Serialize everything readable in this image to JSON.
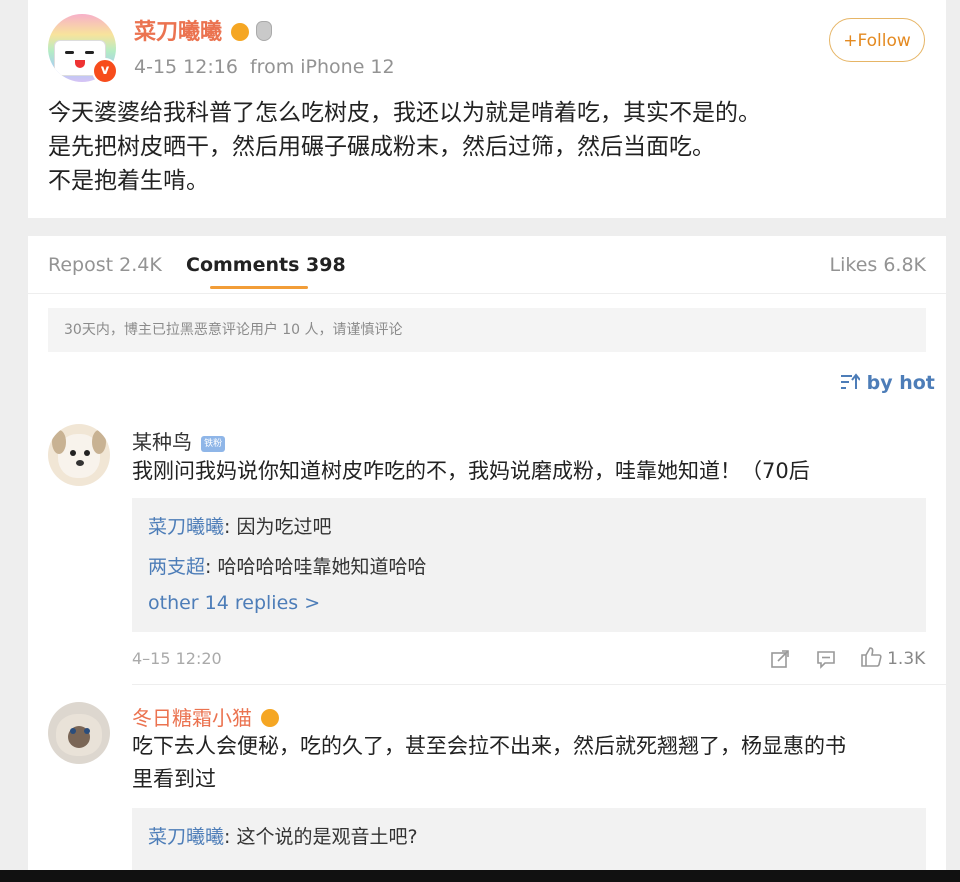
{
  "post": {
    "username": "菜刀曦曦",
    "meta": "4-15 12:16  from iPhone 12",
    "follow_label": "+Follow",
    "verified_mark": "v",
    "lines": [
      "今天婆婆给我科普了怎么吃树皮，我还以为就是啃着吃，其实不是的。",
      "是先把树皮晒干，然后用碾子碾成粉末，然后过筛，然后当面吃。",
      "不是抱着生啃。"
    ]
  },
  "tabs": {
    "repost": "Repost 2.4K",
    "comments": "Comments 398",
    "likes": "Likes 6.8K"
  },
  "notice": "30天内，博主已拉黑恶意评论用户 10 人，请谨慎评论",
  "sort_label": "by hot",
  "comments": [
    {
      "name": "某种鸟",
      "badge": "铁粉",
      "text": "我刚问我妈说你知道树皮咋吃的不，我妈说磨成粉，哇靠她知道！（70后",
      "replies": [
        {
          "name": "菜刀曦曦",
          "text": ": 因为吃过吧"
        },
        {
          "name": "两支超",
          "text": ": 哈哈哈哈哇靠她知道哈哈"
        }
      ],
      "more": "other 14 replies >",
      "time": "4–15 12:20",
      "likes": "1.3K"
    },
    {
      "name": "冬日糖霜小猫",
      "text_lines": [
        "吃下去人会便秘，吃的久了，甚至会拉不出来，然后就死翘翘了，杨显惠的书",
        "里看到过"
      ],
      "replies": [
        {
          "name": "菜刀曦曦",
          "text": ": 这个说的是观音土吧?"
        }
      ]
    }
  ],
  "icons": [
    "verified-icon",
    "level-icon",
    "medal-icon",
    "sort-icon",
    "share-icon",
    "comment-icon",
    "like-icon",
    "vip-icon"
  ],
  "colors": {
    "username": "#eb7350",
    "link": "#4d7db8",
    "accent": "#f29d38",
    "follow_border": "#e6b566"
  }
}
